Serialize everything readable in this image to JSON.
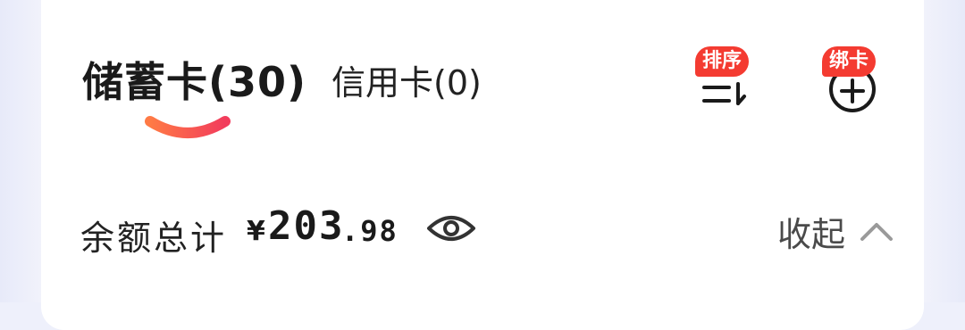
{
  "tabs": {
    "debit_label": "储蓄卡(30)",
    "credit_label": "信用卡(0)"
  },
  "actions": {
    "sort_badge": "排序",
    "bind_badge": "绑卡"
  },
  "balance": {
    "label": "余额总计",
    "currency": "¥",
    "amount_integer": "203",
    "amount_decimal": ".98",
    "collapse_label": "收起"
  },
  "icons": {
    "sort": "sort-icon",
    "bind": "add-circle-icon",
    "eye": "eye-icon",
    "collapse": "chevron-up-icon"
  },
  "colors": {
    "accent_red": "#f43b31",
    "underline_start": "#ff7a45",
    "underline_end": "#f23c5c"
  }
}
